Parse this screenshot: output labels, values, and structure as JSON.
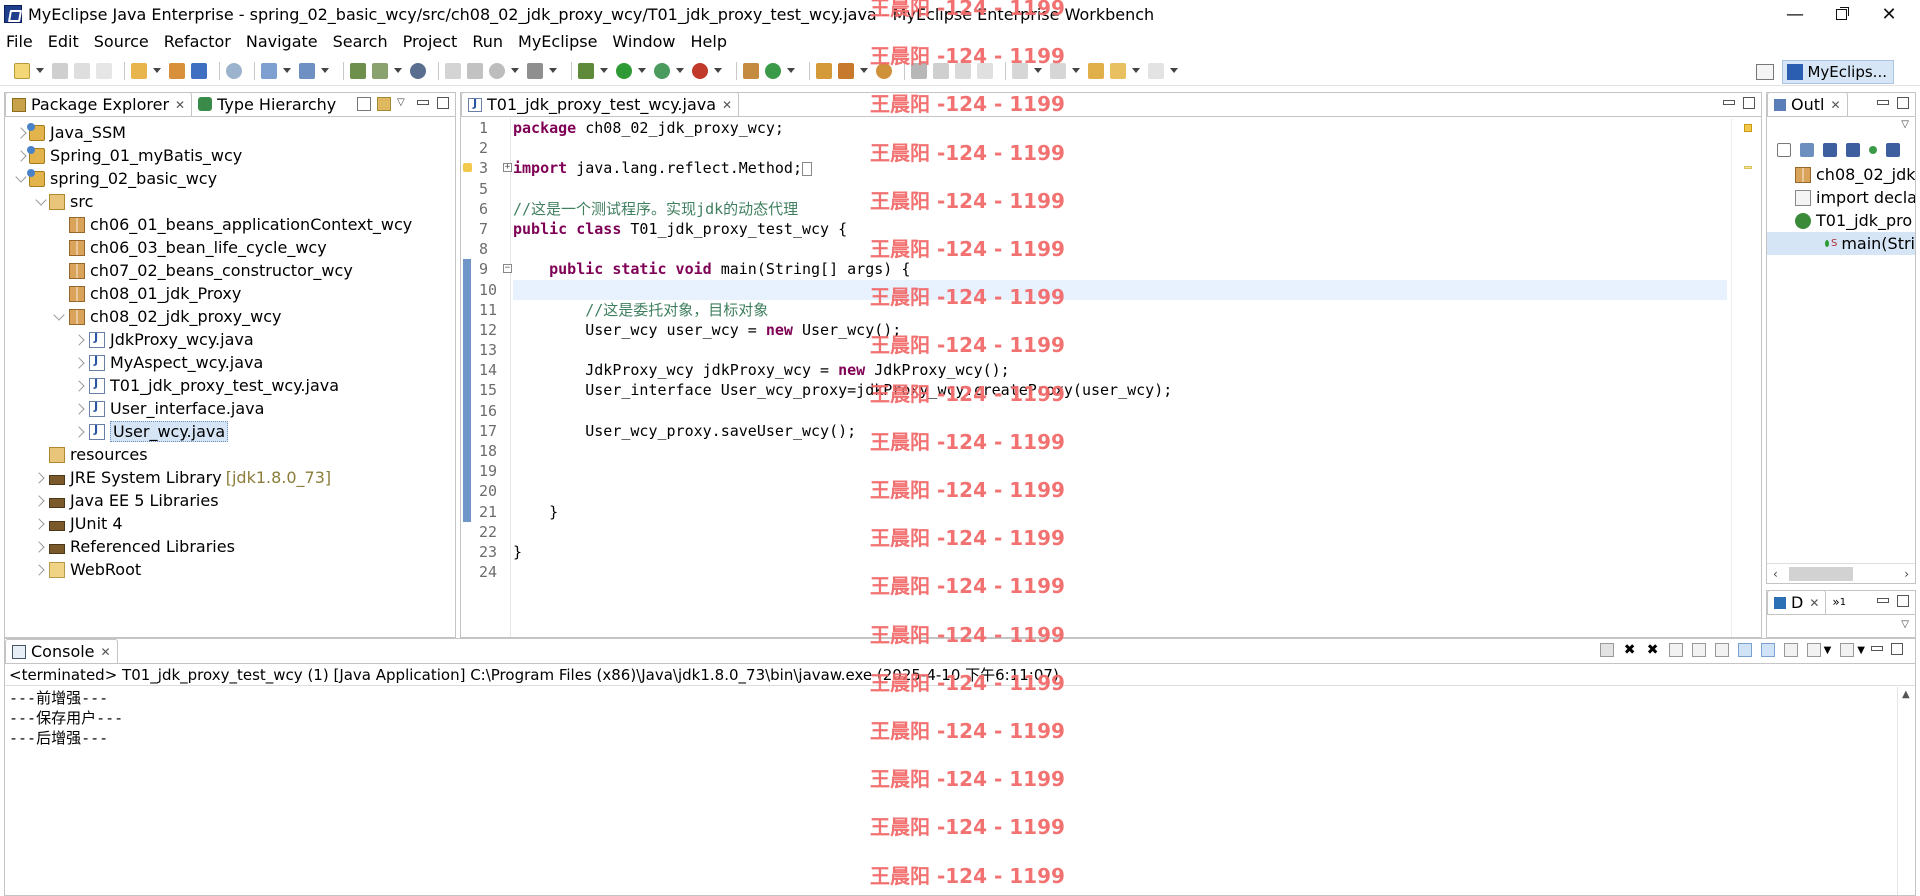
{
  "window": {
    "title": "MyEclipse Java Enterprise - spring_02_basic_wcy/src/ch08_02_jdk_proxy_wcy/T01_jdk_proxy_test_wcy.java - MyEclipse Enterprise Workbench",
    "minimize": "—",
    "close": "✕"
  },
  "menu": [
    "File",
    "Edit",
    "Source",
    "Refactor",
    "Navigate",
    "Search",
    "Project",
    "Run",
    "MyEclipse",
    "Window",
    "Help"
  ],
  "perspective": {
    "label": "MyEclips..."
  },
  "package_explorer": {
    "tabs": [
      {
        "label": "Package Explorer",
        "close": "✕"
      },
      {
        "label": "Type Hierarchy"
      }
    ],
    "tree": [
      {
        "label": "Java_SSM",
        "icon": "project-icon"
      },
      {
        "label": "Spring_01_myBatis_wcy",
        "icon": "project-icon"
      },
      {
        "label": "spring_02_basic_wcy",
        "icon": "project-icon"
      },
      {
        "label": "src",
        "icon": "source-folder-icon"
      },
      {
        "label": "ch06_01_beans_applicationContext_wcy",
        "icon": "package-icon"
      },
      {
        "label": "ch06_03_bean_life_cycle_wcy",
        "icon": "package-icon"
      },
      {
        "label": "ch07_02_beans_constructor_wcy",
        "icon": "package-icon"
      },
      {
        "label": "ch08_01_jdk_Proxy",
        "icon": "package-icon"
      },
      {
        "label": "ch08_02_jdk_proxy_wcy",
        "icon": "package-icon"
      },
      {
        "label": "JdkProxy_wcy.java",
        "icon": "java-file-icon"
      },
      {
        "label": "MyAspect_wcy.java",
        "icon": "java-file-icon"
      },
      {
        "label": "T01_jdk_proxy_test_wcy.java",
        "icon": "java-file-icon"
      },
      {
        "label": "User_interface.java",
        "icon": "java-file-icon"
      },
      {
        "label": "User_wcy.java",
        "icon": "java-file-icon"
      },
      {
        "label": "resources",
        "icon": "source-folder-icon"
      },
      {
        "label": "JRE System Library",
        "extra": "[jdk1.8.0_73]",
        "icon": "library-icon"
      },
      {
        "label": "Java EE 5 Libraries",
        "icon": "library-icon"
      },
      {
        "label": "JUnit 4",
        "icon": "library-icon"
      },
      {
        "label": "Referenced Libraries",
        "icon": "library-icon"
      },
      {
        "label": "WebRoot",
        "icon": "folder-icon"
      }
    ]
  },
  "editor": {
    "tab": {
      "label": "T01_jdk_proxy_test_wcy.java",
      "close": "✕"
    },
    "line_numbers": [
      "1",
      "2",
      "3",
      "5",
      "6",
      "7",
      "8",
      "9",
      "10",
      "11",
      "12",
      "13",
      "14",
      "15",
      "16",
      "17",
      "18",
      "19",
      "20",
      "21",
      "22",
      "23",
      "24"
    ],
    "code": [
      {
        "kw": "package",
        "rest": " ch08_02_jdk_proxy_wcy;"
      },
      {
        "kw": "",
        "rest": ""
      },
      {
        "kw": "import",
        "rest": " java.lang.reflect.Method;"
      },
      {
        "kw": "",
        "rest": ""
      },
      {
        "comment": "//这是一个测试程序。实现jdk的动态代理"
      },
      {
        "kw": "public class",
        "rest": " T01_jdk_proxy_test_wcy {"
      },
      {
        "kw": "",
        "rest": ""
      },
      {
        "indent": "    ",
        "kw": "public static void",
        "rest": " main(String[] args) {"
      },
      {
        "kw": "",
        "rest": ""
      },
      {
        "indent": "        ",
        "comment": "//这是委托对象，目标对象"
      },
      {
        "indent": "        ",
        "pre": "User_wcy user_wcy = ",
        "kw": "new",
        "rest": " User_wcy();"
      },
      {
        "kw": "",
        "rest": ""
      },
      {
        "indent": "        ",
        "pre": "JdkProxy_wcy jdkProxy_wcy = ",
        "kw": "new",
        "rest": " JdkProxy_wcy();"
      },
      {
        "indent": "        ",
        "pre": "User_interface User_wcy_proxy=jdkProxy_wcy.createProxy(user_wcy);",
        "kw": "",
        "rest": ""
      },
      {
        "kw": "",
        "rest": ""
      },
      {
        "indent": "        ",
        "pre": "User_wcy_proxy.saveUser_wcy();",
        "kw": "",
        "rest": ""
      },
      {
        "kw": "",
        "rest": ""
      },
      {
        "kw": "",
        "rest": ""
      },
      {
        "kw": "",
        "rest": ""
      },
      {
        "indent": "    ",
        "pre": "}",
        "kw": "",
        "rest": ""
      },
      {
        "kw": "",
        "rest": ""
      },
      {
        "pre": "}",
        "kw": "",
        "rest": ""
      },
      {
        "kw": "",
        "rest": ""
      }
    ]
  },
  "outline": {
    "tab": {
      "label": "Outl",
      "close": "✕"
    },
    "items": [
      {
        "label": "ch08_02_jdk",
        "icon": "package-icon"
      },
      {
        "label": "import decla",
        "icon": "imports-icon"
      },
      {
        "label": "T01_jdk_pro",
        "icon": "class-icon"
      },
      {
        "label": "main(Stri",
        "icon": "method-icon",
        "modifier": "S"
      }
    ]
  },
  "small_view": {
    "tab1": "D",
    "close": "✕",
    "tab2_count": "1"
  },
  "console": {
    "tab": {
      "label": "Console",
      "close": "✕"
    },
    "status": "<terminated> T01_jdk_proxy_test_wcy (1) [Java Application] C:\\Program Files (x86)\\Java\\jdk1.8.0_73\\bin\\javaw.exe (2025-4-10 下午6:11:07)",
    "output": [
      "---前增强---",
      "---保存用户---",
      "---后增强---"
    ]
  },
  "watermark": {
    "text": "王晨阳 -124 - 1199",
    "count": 19
  },
  "colors": {
    "keyword": "#7f0055",
    "comment": "#3f7f5f",
    "watermark": "#f26b6b",
    "selection": "#d5e5f5",
    "current_line": "#e8f2fe"
  }
}
